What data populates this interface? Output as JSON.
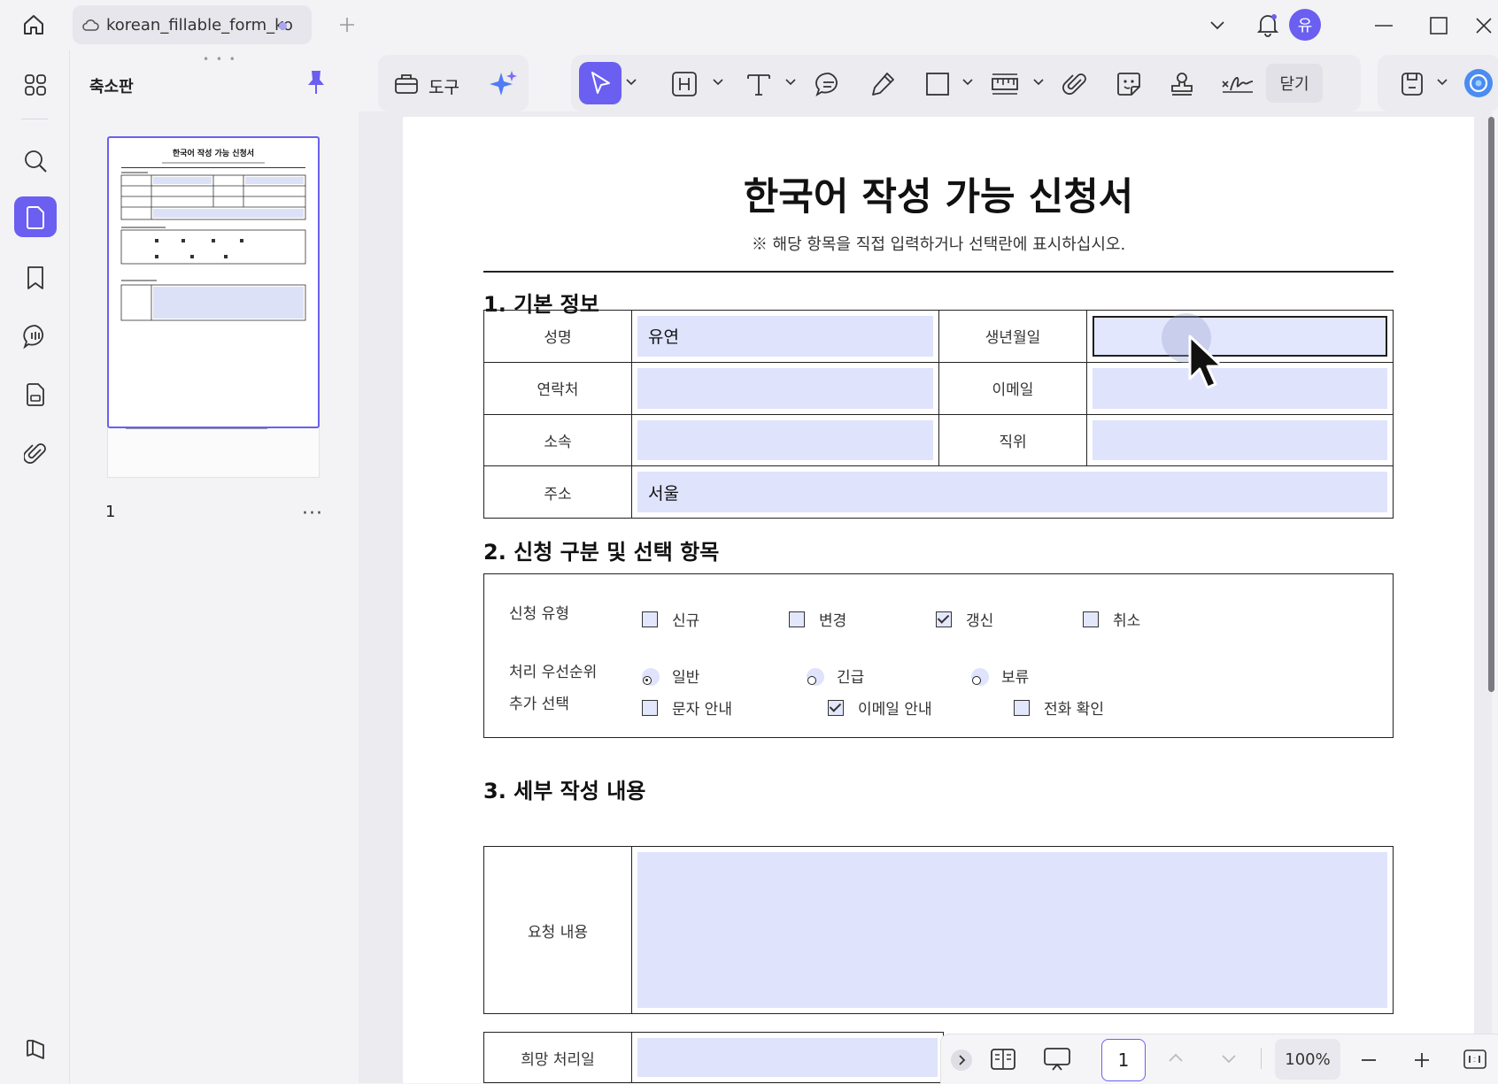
{
  "titlebar": {
    "tab_title": "korean_fillable_form_ko",
    "avatar_initial": "유"
  },
  "panel": {
    "title": "축소판",
    "page_number": "1",
    "more": "···"
  },
  "toolbar": {
    "tools_label": "도구",
    "close_label": "닫기"
  },
  "document": {
    "title": "한국어 작성 가능 신청서",
    "subtitle": "※ 해당 항목을 직접 입력하거나 선택란에 표시하십시오.",
    "section1": "1. 기본 정보",
    "section2": "2. 신청 구분 및 선택 항목",
    "section3": "3. 세부 작성 내용",
    "basic": {
      "name_label": "성명",
      "name_value": "유연",
      "birth_label": "생년월일",
      "birth_value": "",
      "contact_label": "연락처",
      "contact_value": "",
      "email_label": "이메일",
      "email_value": "",
      "affiliation_label": "소속",
      "affiliation_value": "",
      "position_label": "직위",
      "position_value": "",
      "address_label": "주소",
      "address_value": "서울"
    },
    "application": {
      "type_label": "신청 유형",
      "types": [
        {
          "label": "신규",
          "checked": false
        },
        {
          "label": "변경",
          "checked": false
        },
        {
          "label": "갱신",
          "checked": true
        },
        {
          "label": "취소",
          "checked": false
        }
      ],
      "priority_label": "처리 우선순위",
      "priorities": [
        {
          "label": "일반",
          "selected": true
        },
        {
          "label": "긴급",
          "selected": false
        },
        {
          "label": "보류",
          "selected": false
        }
      ],
      "extra_label": "추가 선택",
      "extras": [
        {
          "label": "문자 안내",
          "checked": false
        },
        {
          "label": "이메일 안내",
          "checked": true
        },
        {
          "label": "전화 확인",
          "checked": false
        }
      ]
    },
    "details": {
      "request_label": "요청 내용",
      "request_value": "",
      "date_label": "희망 처리일",
      "date_value": ""
    }
  },
  "bottombar": {
    "page": "1",
    "zoom": "100%"
  }
}
